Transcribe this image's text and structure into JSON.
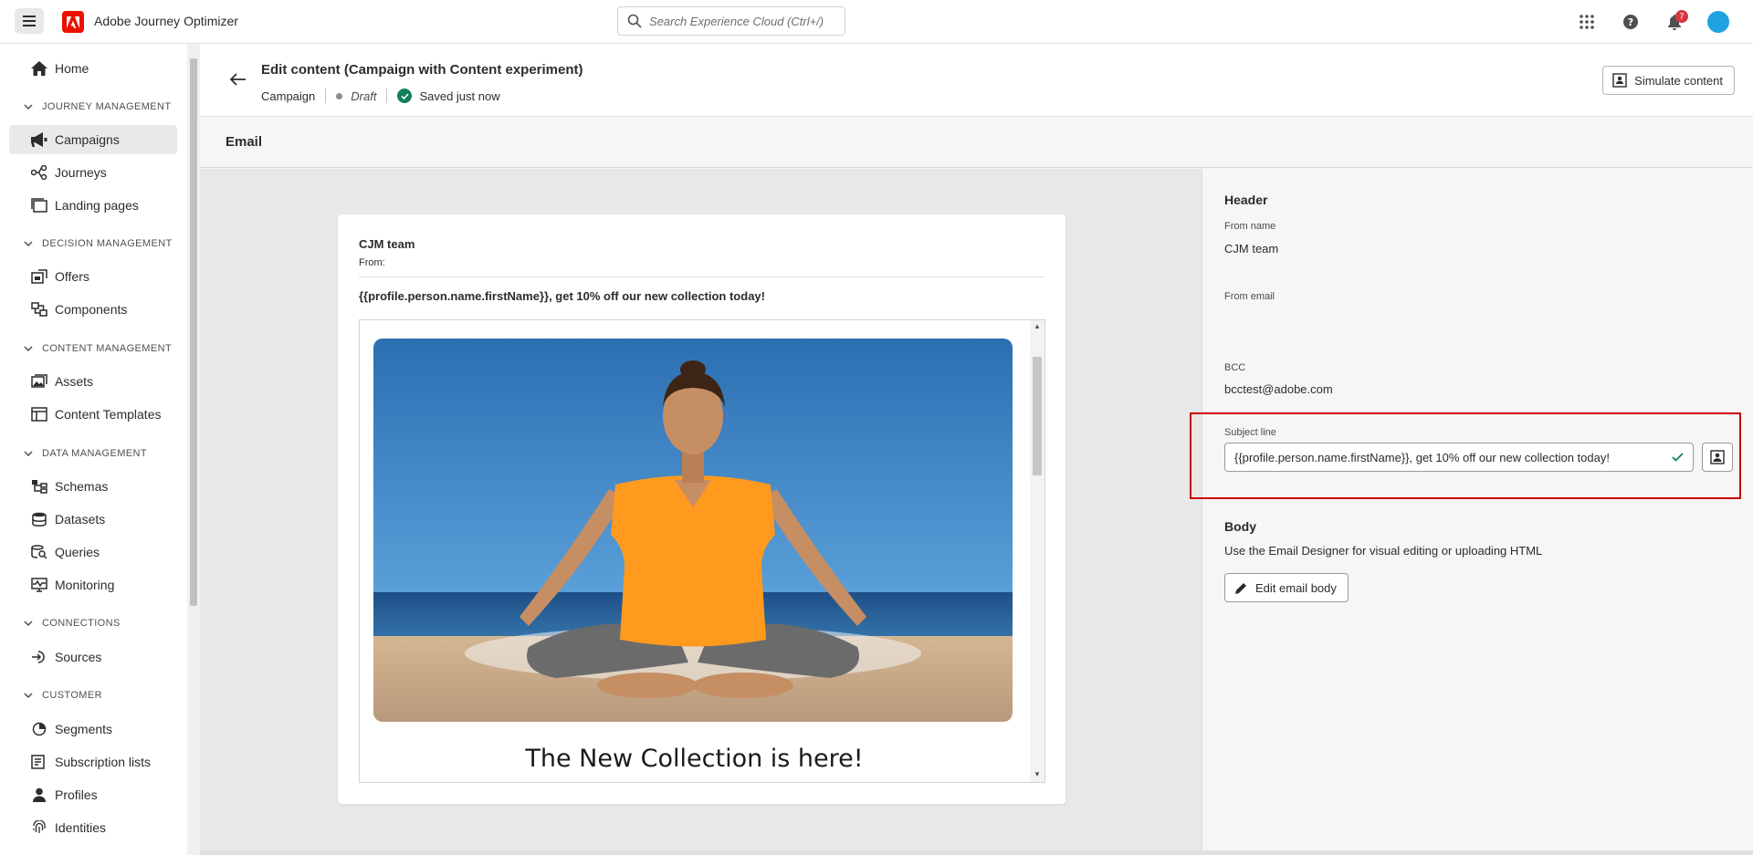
{
  "app": {
    "title": "Adobe Journey Optimizer",
    "search_placeholder": "Search Experience Cloud (Ctrl+/)",
    "notification_count": "7",
    "accent_color": "#eb1000"
  },
  "sidebar": {
    "items": [
      {
        "label": "Home",
        "icon": "home-icon"
      },
      {
        "section": "JOURNEY MANAGEMENT"
      },
      {
        "label": "Campaigns",
        "icon": "megaphone-icon",
        "active": true
      },
      {
        "label": "Journeys",
        "icon": "journey-icon"
      },
      {
        "label": "Landing pages",
        "icon": "landing-page-icon"
      },
      {
        "section": "DECISION MANAGEMENT"
      },
      {
        "label": "Offers",
        "icon": "offer-icon"
      },
      {
        "label": "Components",
        "icon": "components-icon"
      },
      {
        "section": "CONTENT MANAGEMENT"
      },
      {
        "label": "Assets",
        "icon": "assets-icon"
      },
      {
        "label": "Content Templates",
        "icon": "template-icon"
      },
      {
        "section": "DATA MANAGEMENT"
      },
      {
        "label": "Schemas",
        "icon": "schema-icon"
      },
      {
        "label": "Datasets",
        "icon": "dataset-icon"
      },
      {
        "label": "Queries",
        "icon": "query-icon"
      },
      {
        "label": "Monitoring",
        "icon": "monitoring-icon"
      },
      {
        "section": "CONNECTIONS"
      },
      {
        "label": "Sources",
        "icon": "sources-icon"
      },
      {
        "section": "CUSTOMER"
      },
      {
        "label": "Segments",
        "icon": "segments-icon"
      },
      {
        "label": "Subscription lists",
        "icon": "subscription-icon"
      },
      {
        "label": "Profiles",
        "icon": "profile-icon"
      },
      {
        "label": "Identities",
        "icon": "fingerprint-icon"
      }
    ]
  },
  "header": {
    "title": "Edit content (Campaign with Content experiment)",
    "type": "Campaign",
    "status": "Draft",
    "saved": "Saved just now",
    "simulate_label": "Simulate content"
  },
  "section": {
    "title": "Email"
  },
  "preview": {
    "from_name": "CJM team",
    "from_label": "From:",
    "subject": "{{profile.person.name.firstName}}, get 10% off our new collection today!",
    "headline": "The New Collection is here!"
  },
  "panel": {
    "header_heading": "Header",
    "from_name_label": "From name",
    "from_name_value": "CJM team",
    "from_email_label": "From email",
    "bcc_label": "BCC",
    "bcc_value": "bcctest@adobe.com",
    "subject_label": "Subject line",
    "subject_value": "{{profile.person.name.firstName}}, get 10% off our new collection today!",
    "body_heading": "Body",
    "body_desc": "Use the Email Designer for visual editing or uploading HTML",
    "edit_body_label": "Edit email body"
  }
}
